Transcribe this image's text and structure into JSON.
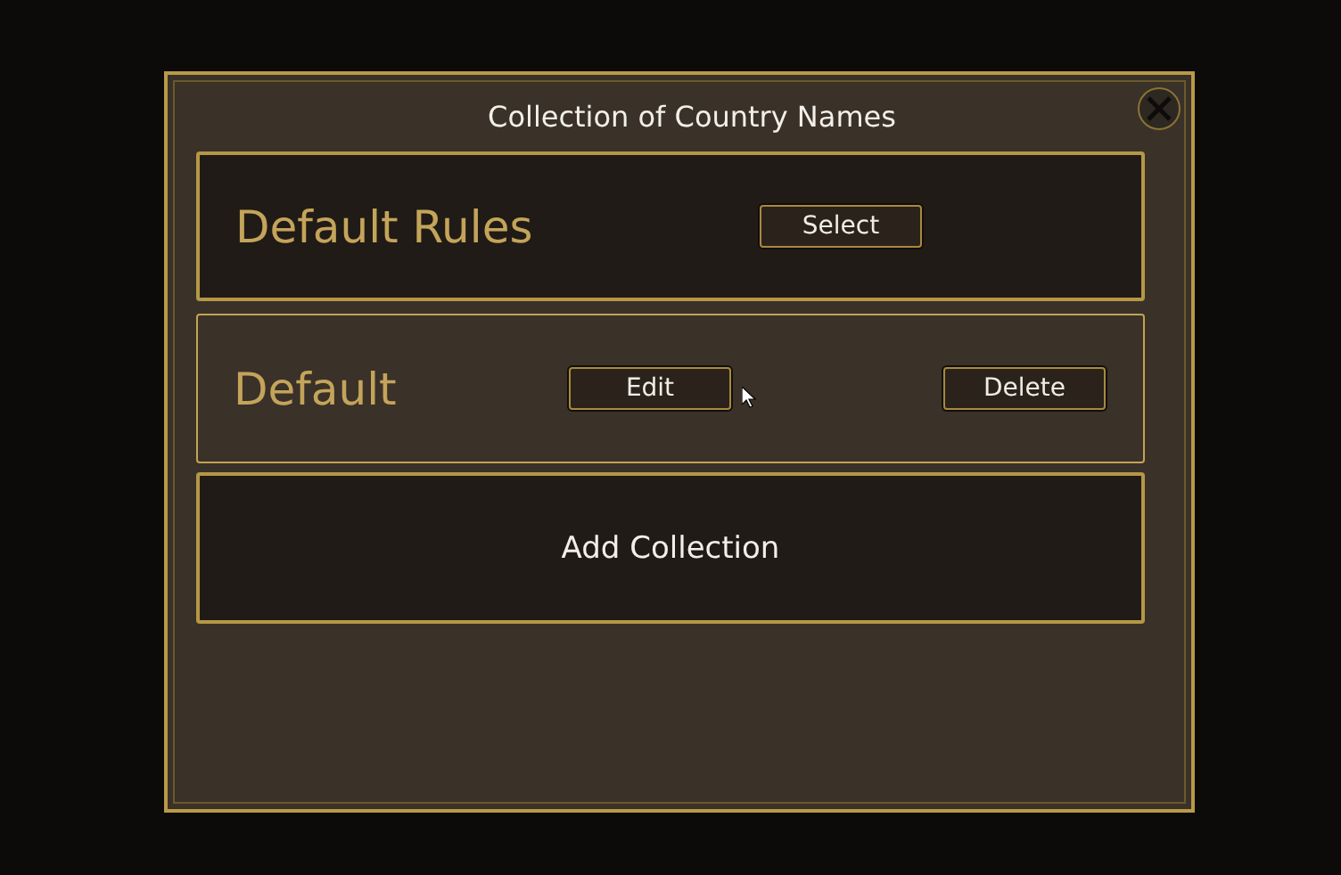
{
  "dialog": {
    "title": "Collection of Country Names"
  },
  "rows": [
    {
      "kind": "rules",
      "name": "Default Rules",
      "selected": false,
      "buttons": [
        "Select"
      ]
    },
    {
      "kind": "collection",
      "name": "Default",
      "selected": true,
      "buttons": [
        "Edit",
        "Delete"
      ]
    }
  ],
  "add_button": "Add Collection"
}
